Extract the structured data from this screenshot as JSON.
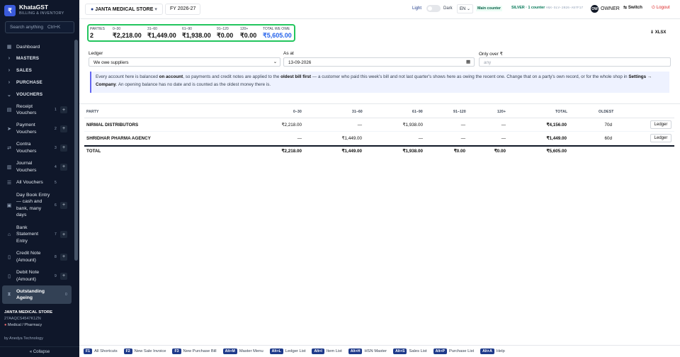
{
  "brand": {
    "name": "KhataGST",
    "subtitle": "BILLING & INVENTORY",
    "logo_glyph": "₹"
  },
  "search": {
    "placeholder": "Search anything",
    "shortcut": "Ctrl+K"
  },
  "nav": {
    "dashboard": "Dashboard",
    "masters": "MASTERS",
    "sales": "SALES",
    "purchase": "PURCHASE",
    "vouchers": "VOUCHERS"
  },
  "voucher_items": [
    {
      "label": "Receipt Vouchers",
      "num": "1"
    },
    {
      "label": "Payment Vouchers",
      "num": "2"
    },
    {
      "label": "Contra Vouchers",
      "num": "3"
    },
    {
      "label": "Journal Vouchers",
      "num": "4"
    },
    {
      "label": "All Vouchers",
      "num": "5"
    },
    {
      "label": "Day Book Entry — cash and bank, many days",
      "num": "6"
    },
    {
      "label": "Bank Statement Entry",
      "num": "7"
    },
    {
      "label": "Credit Note (Amount)",
      "num": "8"
    },
    {
      "label": "Debit Note (Amount)",
      "num": "9"
    },
    {
      "label": "Outstanding Ageing",
      "num": "0"
    }
  ],
  "store": {
    "name": "JANTA MEDICAL STORE",
    "gstin": "27AAQCS4547K1ZN",
    "category": "Medical / Pharmacy"
  },
  "by": "by Anedya Technology",
  "collapse": "« Collapse",
  "topbar": {
    "company": "JANTA MEDICAL STORE",
    "fy": "FY 2026-27",
    "light": "Light",
    "dark": "Dark",
    "lang": "EN",
    "main_counter": "Main counter",
    "plan": "SILVER · 1 counter",
    "plan_code": "ANX-SLV-2026-A57F17",
    "owner_initial": "OW",
    "owner": "OWNER",
    "switch": "Switch",
    "logout": "Logout"
  },
  "summary": [
    {
      "label": "PARTIES",
      "value": "2"
    },
    {
      "label": "0–30",
      "value": "₹2,218.00"
    },
    {
      "label": "31–60",
      "value": "₹1,449.00"
    },
    {
      "label": "61–90",
      "value": "₹1,938.00"
    },
    {
      "label": "91–120",
      "value": "₹0.00"
    },
    {
      "label": "120+",
      "value": "₹0.00"
    },
    {
      "label": "TOTAL WE OWE",
      "value": "₹5,605.00"
    }
  ],
  "xlsx": "XLSX",
  "filters": {
    "ledger_label": "Ledger",
    "ledger_value": "We owe suppliers",
    "asat_label": "As at",
    "asat_value": "13-09-2026",
    "only_over_label": "Only over ₹",
    "only_over_placeholder": "any"
  },
  "info": {
    "p1": "Every account here is balanced ",
    "b1": "on account",
    "p2": ", so payments and credit notes are applied to the ",
    "b2": "oldest bill first",
    "p3": " — a customer who paid this week's bill and not last quarter's shows here as owing the recent one. Change that on a party's own record, or for the whole shop in ",
    "b3": "Settings → Company",
    "p4": ". An opening balance has no date and is counted as the oldest money there is."
  },
  "table": {
    "headers": [
      "PARTY",
      "0–30",
      "31–60",
      "61–90",
      "91–120",
      "120+",
      "TOTAL",
      "OLDEST"
    ],
    "rows": [
      {
        "party": "NIRMAL DISTRIBUTORS",
        "c0": "₹2,218.00",
        "c1": "—",
        "c2": "₹1,938.00",
        "c3": "—",
        "c4": "—",
        "total": "₹4,156.00",
        "oldest": "70d",
        "action": "Ledger"
      },
      {
        "party": "SHRIDHAR PHARMA AGENCY",
        "c0": "—",
        "c1": "₹1,449.00",
        "c2": "—",
        "c3": "—",
        "c4": "—",
        "total": "₹1,449.00",
        "oldest": "60d",
        "action": "Ledger"
      }
    ],
    "total": {
      "label": "TOTAL",
      "c0": "₹2,218.00",
      "c1": "₹1,449.00",
      "c2": "₹1,938.00",
      "c3": "₹0.00",
      "c4": "₹0.00",
      "total": "₹5,605.00"
    }
  },
  "footer": [
    {
      "key": "F1",
      "label": "All Shortcuts"
    },
    {
      "key": "F2",
      "label": "New Sale Invoice"
    },
    {
      "key": "F3",
      "label": "New Purchase Bill"
    },
    {
      "key": "Alt+M",
      "label": "Master Menu"
    },
    {
      "key": "Alt+L",
      "label": "Ledger List"
    },
    {
      "key": "Alt+I",
      "label": "Item List"
    },
    {
      "key": "Alt+H",
      "label": "HSN Master"
    },
    {
      "key": "Alt+S",
      "label": "Sales List"
    },
    {
      "key": "Alt+P",
      "label": "Purchase List"
    },
    {
      "key": "Alt+A",
      "label": "Help"
    }
  ],
  "colors": {
    "sidebar_bg": "#0f172a",
    "accent": "#2563eb",
    "highlight_border": "#22c55e",
    "logout": "#dc2626"
  }
}
